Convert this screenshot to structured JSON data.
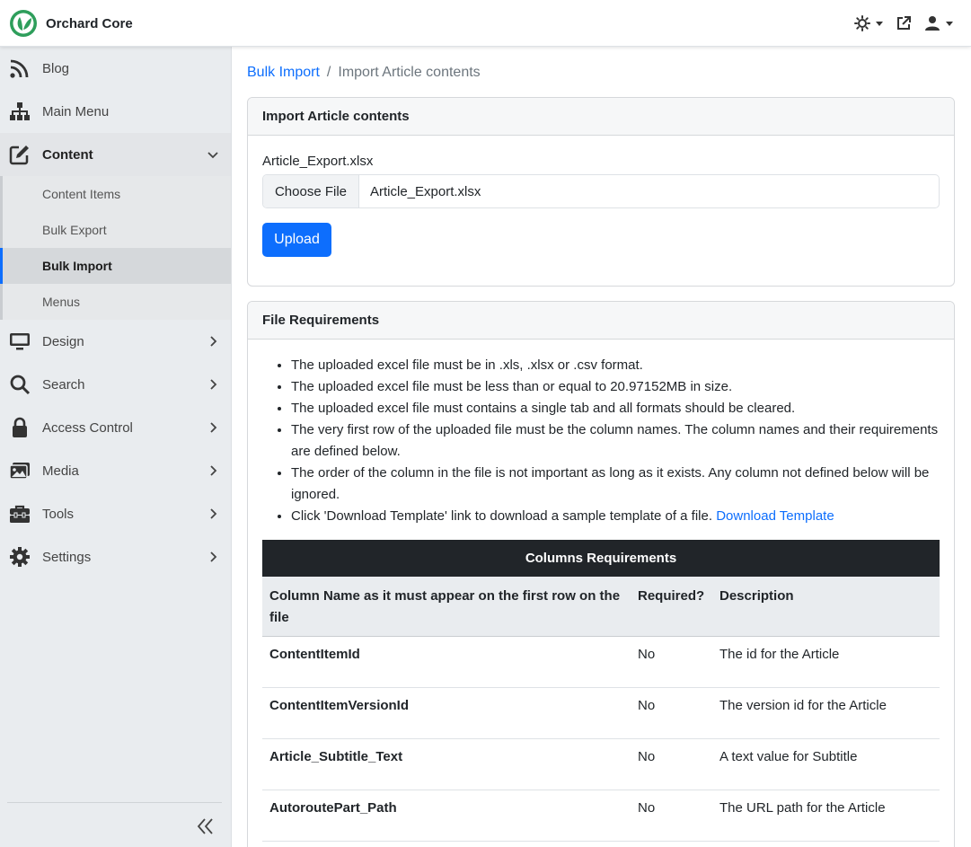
{
  "app": {
    "name": "Orchard Core"
  },
  "topbar": {
    "theme_icon": "sun-icon",
    "external_icon": "external-link-icon",
    "user_icon": "user-icon"
  },
  "sidebar": {
    "items": [
      {
        "label": "Blog",
        "icon": "rss-icon"
      },
      {
        "label": "Main Menu",
        "icon": "sitemap-icon"
      },
      {
        "label": "Content",
        "icon": "edit-icon"
      },
      {
        "label": "Design",
        "icon": "monitor-icon"
      },
      {
        "label": "Search",
        "icon": "search-icon"
      },
      {
        "label": "Access Control",
        "icon": "lock-icon"
      },
      {
        "label": "Media",
        "icon": "images-icon"
      },
      {
        "label": "Tools",
        "icon": "toolbox-icon"
      },
      {
        "label": "Settings",
        "icon": "gear-icon"
      }
    ],
    "content_sub": [
      {
        "label": "Content Items"
      },
      {
        "label": "Bulk Export"
      },
      {
        "label": "Bulk Import"
      },
      {
        "label": "Menus"
      }
    ]
  },
  "breadcrumb": {
    "parent": "Bulk Import",
    "separator": "/",
    "current": "Import Article contents"
  },
  "import_card": {
    "title": "Import Article contents",
    "file_label": "Article_Export.xlsx",
    "choose_label": "Choose File",
    "file_name": "Article_Export.xlsx",
    "upload_label": "Upload"
  },
  "requirements_card": {
    "title": "File Requirements",
    "items": [
      "The uploaded excel file must be in .xls, .xlsx or .csv format.",
      "The uploaded excel file must be less than or equal to 20.97152MB in size.",
      "The uploaded excel file must contains a single tab and all formats should be cleared.",
      "The very first row of the uploaded file must be the column names. The column names and their requirements are defined below.",
      "The order of the column in the file is not important as long as it exists. Any column not defined below will be ignored."
    ],
    "template_text": "Click 'Download Template' link to download a sample template of a file. ",
    "template_link": "Download Template",
    "table": {
      "caption": "Columns Requirements",
      "headers": [
        "Column Name as it must appear on the first row on the file",
        "Required?",
        "Description"
      ],
      "rows": [
        {
          "name": "ContentItemId",
          "required": "No",
          "description": "The id for the Article"
        },
        {
          "name": "ContentItemVersionId",
          "required": "No",
          "description": "The version id for the Article"
        },
        {
          "name": "Article_Subtitle_Text",
          "required": "No",
          "description": "A text value for Subtitle"
        },
        {
          "name": "AutoroutePart_Path",
          "required": "No",
          "description": "The URL path for the Article"
        }
      ]
    }
  },
  "colors": {
    "accent": "#0d6efd",
    "brand": "#2e9e5b",
    "sidebar_bg": "#e9ecef",
    "table_dark": "#212529"
  }
}
